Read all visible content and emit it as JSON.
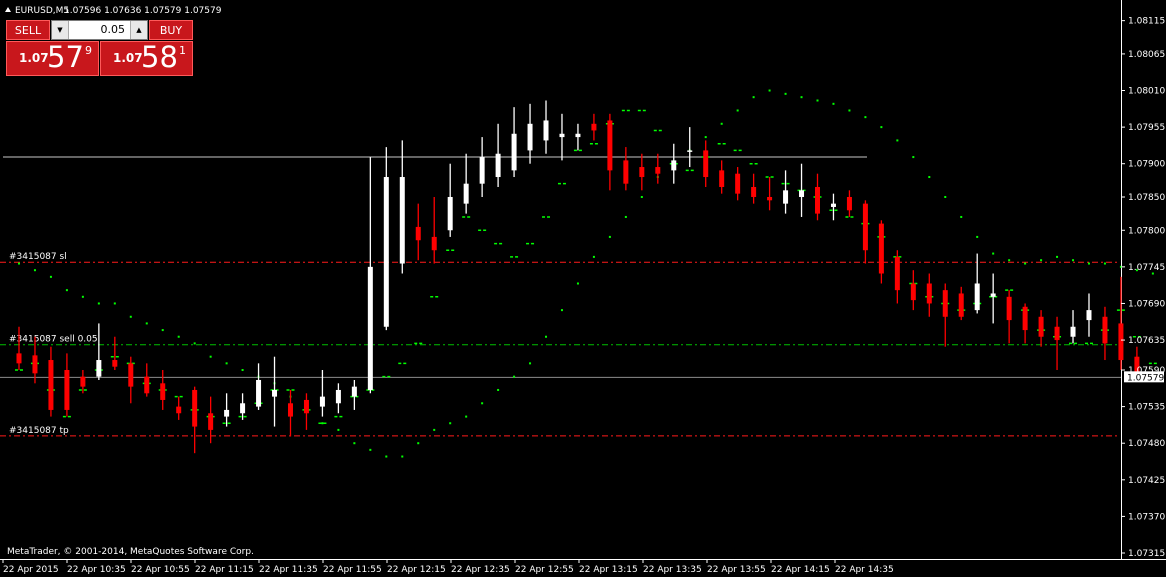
{
  "header": {
    "symbol": "EURUSD,M5",
    "ohlc": "1.07596 1.07636 1.07579 1.07579"
  },
  "trade_panel": {
    "sell_label": "SELL",
    "buy_label": "BUY",
    "lot": "0.05",
    "sell_price": {
      "big": "1.07",
      "main": "57",
      "sup": "9"
    },
    "buy_price": {
      "big": "1.07",
      "main": "58",
      "sup": "1"
    }
  },
  "copyright": "MetaTrader, © 2001-2014, MetaQuotes Software Corp.",
  "order_lines": {
    "sl_label": "#3415087 sl",
    "entry_label": "#3415087 sell 0.05",
    "tp_label": "#3415087 tp"
  },
  "current_price": "1.07579",
  "colors": {
    "background": "#000000",
    "bull": "#ffffff",
    "bear": "#ff0000",
    "moving_average": "#00ff00",
    "sar_dots": "#00ff00",
    "order_line": "#ff0000",
    "entry_line": "#00c000",
    "price_label_bg": "#ffffff"
  },
  "chart_data": {
    "type": "candlestick",
    "symbol": "EURUSD",
    "timeframe": "M5",
    "y_ticks": [
      "1.08115",
      "1.08065",
      "1.08010",
      "1.07955",
      "1.07900",
      "1.07850",
      "1.07800",
      "1.07745",
      "1.07690",
      "1.07635",
      "1.07590",
      "1.07535",
      "1.07480",
      "1.07425",
      "1.07370",
      "1.07315"
    ],
    "x_ticks": [
      "22 Apr 2015",
      "22 Apr 10:35",
      "22 Apr 10:55",
      "22 Apr 11:15",
      "22 Apr 11:35",
      "22 Apr 11:55",
      "22 Apr 12:15",
      "22 Apr 12:35",
      "22 Apr 12:55",
      "22 Apr 13:15",
      "22 Apr 13:35",
      "22 Apr 13:55",
      "22 Apr 14:15",
      "22 Apr 14:35"
    ],
    "ylim": [
      1.07309,
      1.08137
    ],
    "horizontal_lines": {
      "white_level": 1.0791,
      "stop_loss": 1.07752,
      "entry": 1.07628,
      "take_profit": 1.07491,
      "current": 1.07579
    },
    "candles": [
      {
        "o": 1.07615,
        "h": 1.07655,
        "l": 1.0759,
        "c": 1.076
      },
      {
        "o": 1.07612,
        "h": 1.0764,
        "l": 1.0757,
        "c": 1.07585
      },
      {
        "o": 1.07605,
        "h": 1.07625,
        "l": 1.0752,
        "c": 1.0753
      },
      {
        "o": 1.0759,
        "h": 1.07615,
        "l": 1.0752,
        "c": 1.0753
      },
      {
        "o": 1.0758,
        "h": 1.0759,
        "l": 1.07555,
        "c": 1.07565
      },
      {
        "o": 1.0758,
        "h": 1.0766,
        "l": 1.07575,
        "c": 1.07605
      },
      {
        "o": 1.07605,
        "h": 1.0764,
        "l": 1.0759,
        "c": 1.07595
      },
      {
        "o": 1.076,
        "h": 1.0761,
        "l": 1.0754,
        "c": 1.07565
      },
      {
        "o": 1.0758,
        "h": 1.076,
        "l": 1.0755,
        "c": 1.07555
      },
      {
        "o": 1.0757,
        "h": 1.0759,
        "l": 1.0753,
        "c": 1.07545
      },
      {
        "o": 1.07535,
        "h": 1.0755,
        "l": 1.07515,
        "c": 1.07525
      },
      {
        "o": 1.0756,
        "h": 1.07565,
        "l": 1.07465,
        "c": 1.07505
      },
      {
        "o": 1.07525,
        "h": 1.0755,
        "l": 1.0748,
        "c": 1.075
      },
      {
        "o": 1.0752,
        "h": 1.07555,
        "l": 1.07505,
        "c": 1.0753
      },
      {
        "o": 1.07525,
        "h": 1.07555,
        "l": 1.07515,
        "c": 1.0754
      },
      {
        "o": 1.07535,
        "h": 1.076,
        "l": 1.0753,
        "c": 1.07575
      },
      {
        "o": 1.0755,
        "h": 1.0761,
        "l": 1.07505,
        "c": 1.0756
      },
      {
        "o": 1.0754,
        "h": 1.0756,
        "l": 1.0749,
        "c": 1.0752
      },
      {
        "o": 1.07545,
        "h": 1.07555,
        "l": 1.075,
        "c": 1.07525
      },
      {
        "o": 1.07535,
        "h": 1.0759,
        "l": 1.0752,
        "c": 1.0755
      },
      {
        "o": 1.0754,
        "h": 1.0757,
        "l": 1.07525,
        "c": 1.0756
      },
      {
        "o": 1.0755,
        "h": 1.07575,
        "l": 1.0753,
        "c": 1.07565
      },
      {
        "o": 1.0756,
        "h": 1.0791,
        "l": 1.07555,
        "c": 1.07745
      },
      {
        "o": 1.07655,
        "h": 1.07925,
        "l": 1.0765,
        "c": 1.0788
      },
      {
        "o": 1.0775,
        "h": 1.07935,
        "l": 1.07735,
        "c": 1.0788
      },
      {
        "o": 1.07805,
        "h": 1.0784,
        "l": 1.07755,
        "c": 1.07785
      },
      {
        "o": 1.0779,
        "h": 1.0785,
        "l": 1.0775,
        "c": 1.0777
      },
      {
        "o": 1.078,
        "h": 1.079,
        "l": 1.0779,
        "c": 1.0785
      },
      {
        "o": 1.0784,
        "h": 1.07915,
        "l": 1.07825,
        "c": 1.0787
      },
      {
        "o": 1.0787,
        "h": 1.0794,
        "l": 1.0785,
        "c": 1.0791
      },
      {
        "o": 1.0788,
        "h": 1.0796,
        "l": 1.07865,
        "c": 1.07915
      },
      {
        "o": 1.0789,
        "h": 1.07985,
        "l": 1.0788,
        "c": 1.07945
      },
      {
        "o": 1.0792,
        "h": 1.0799,
        "l": 1.079,
        "c": 1.0796
      },
      {
        "o": 1.07935,
        "h": 1.07995,
        "l": 1.07915,
        "c": 1.07965
      },
      {
        "o": 1.0794,
        "h": 1.07975,
        "l": 1.07905,
        "c": 1.07945
      },
      {
        "o": 1.0794,
        "h": 1.0796,
        "l": 1.0792,
        "c": 1.07945
      },
      {
        "o": 1.0796,
        "h": 1.07975,
        "l": 1.07935,
        "c": 1.0795
      },
      {
        "o": 1.07965,
        "h": 1.07975,
        "l": 1.0786,
        "c": 1.0789
      },
      {
        "o": 1.07905,
        "h": 1.07925,
        "l": 1.0786,
        "c": 1.0787
      },
      {
        "o": 1.07895,
        "h": 1.07915,
        "l": 1.0786,
        "c": 1.0788
      },
      {
        "o": 1.07895,
        "h": 1.07915,
        "l": 1.0787,
        "c": 1.07885
      },
      {
        "o": 1.0789,
        "h": 1.0793,
        "l": 1.0787,
        "c": 1.07905
      },
      {
        "o": 1.0792,
        "h": 1.07955,
        "l": 1.07895,
        "c": 1.0792
      },
      {
        "o": 1.0792,
        "h": 1.07935,
        "l": 1.07865,
        "c": 1.0788
      },
      {
        "o": 1.0789,
        "h": 1.07905,
        "l": 1.07855,
        "c": 1.07865
      },
      {
        "o": 1.07885,
        "h": 1.07895,
        "l": 1.07845,
        "c": 1.07855
      },
      {
        "o": 1.07865,
        "h": 1.07885,
        "l": 1.0784,
        "c": 1.0785
      },
      {
        "o": 1.0785,
        "h": 1.0788,
        "l": 1.0783,
        "c": 1.07845
      },
      {
        "o": 1.0784,
        "h": 1.0789,
        "l": 1.07825,
        "c": 1.0786
      },
      {
        "o": 1.0785,
        "h": 1.079,
        "l": 1.0782,
        "c": 1.0786
      },
      {
        "o": 1.07865,
        "h": 1.07885,
        "l": 1.07815,
        "c": 1.07825
      },
      {
        "o": 1.07835,
        "h": 1.07855,
        "l": 1.07815,
        "c": 1.0784
      },
      {
        "o": 1.0785,
        "h": 1.0786,
        "l": 1.0782,
        "c": 1.0783
      },
      {
        "o": 1.0784,
        "h": 1.07845,
        "l": 1.0775,
        "c": 1.0777
      },
      {
        "o": 1.0781,
        "h": 1.07815,
        "l": 1.0772,
        "c": 1.07735
      },
      {
        "o": 1.0776,
        "h": 1.0777,
        "l": 1.0769,
        "c": 1.0771
      },
      {
        "o": 1.0772,
        "h": 1.0774,
        "l": 1.0768,
        "c": 1.07695
      },
      {
        "o": 1.0772,
        "h": 1.07735,
        "l": 1.0767,
        "c": 1.0769
      },
      {
        "o": 1.0771,
        "h": 1.0772,
        "l": 1.07625,
        "c": 1.0767
      },
      {
        "o": 1.07705,
        "h": 1.07715,
        "l": 1.07665,
        "c": 1.0767
      },
      {
        "o": 1.0768,
        "h": 1.07765,
        "l": 1.07675,
        "c": 1.0772
      },
      {
        "o": 1.077,
        "h": 1.07735,
        "l": 1.0766,
        "c": 1.07705
      },
      {
        "o": 1.077,
        "h": 1.0771,
        "l": 1.0763,
        "c": 1.07665
      },
      {
        "o": 1.07685,
        "h": 1.0769,
        "l": 1.0763,
        "c": 1.0765
      },
      {
        "o": 1.0767,
        "h": 1.0768,
        "l": 1.07625,
        "c": 1.0764
      },
      {
        "o": 1.07655,
        "h": 1.0767,
        "l": 1.0759,
        "c": 1.07635
      },
      {
        "o": 1.0764,
        "h": 1.0768,
        "l": 1.0763,
        "c": 1.07655
      },
      {
        "o": 1.07665,
        "h": 1.07705,
        "l": 1.0764,
        "c": 1.0768
      },
      {
        "o": 1.0767,
        "h": 1.07685,
        "l": 1.07605,
        "c": 1.0763
      },
      {
        "o": 1.0766,
        "h": 1.0773,
        "l": 1.0759,
        "c": 1.07605
      },
      {
        "o": 1.0761,
        "h": 1.07625,
        "l": 1.07578,
        "c": 1.07585
      }
    ],
    "moving_average_series": [
      1.0759,
      1.076,
      1.0756,
      1.0752,
      1.0756,
      1.0759,
      1.0761,
      1.076,
      1.0757,
      1.0756,
      1.0755,
      1.0753,
      1.0752,
      1.0751,
      1.0752,
      1.0754,
      1.0756,
      1.0756,
      1.0753,
      1.0751,
      1.0752,
      1.0755,
      1.0756,
      1.0758,
      1.076,
      1.0763,
      1.077,
      1.0777,
      1.0782,
      1.078,
      1.0778,
      1.0776,
      1.0778,
      1.0782,
      1.0787,
      1.0792,
      1.0793,
      1.0796,
      1.0798,
      1.0798,
      1.0795,
      1.079,
      1.0789,
      1.0791,
      1.0793,
      1.0792,
      1.079,
      1.0788,
      1.0787,
      1.0786,
      1.0785,
      1.0783,
      1.0782,
      1.0781,
      1.0779,
      1.0776,
      1.0772,
      1.077,
      1.0769,
      1.0768,
      1.0769,
      1.077,
      1.0771,
      1.0768,
      1.0765,
      1.0764,
      1.0763,
      1.0763,
      1.0765,
      1.0768,
      1.0764,
      1.076
    ],
    "parabolic_sar": [
      1.0775,
      1.0774,
      1.0773,
      1.0771,
      1.077,
      1.0769,
      1.0769,
      1.0767,
      1.0766,
      1.0765,
      1.0764,
      1.0763,
      1.0761,
      1.076,
      1.0759,
      1.0758,
      1.0757,
      1.0755,
      1.0753,
      1.0751,
      1.075,
      1.0748,
      1.0747,
      1.0746,
      1.0746,
      1.0748,
      1.075,
      1.0751,
      1.0752,
      1.0754,
      1.0756,
      1.0758,
      1.076,
      1.0764,
      1.0768,
      1.0772,
      1.0776,
      1.0779,
      1.0782,
      1.0785,
      1.0788,
      1.079,
      1.0792,
      1.0794,
      1.0796,
      1.0798,
      1.08,
      1.0801,
      1.08005,
      1.08,
      1.07995,
      1.0799,
      1.0798,
      1.0797,
      1.07955,
      1.07935,
      1.0791,
      1.0788,
      1.0785,
      1.0782,
      1.0779,
      1.07765,
      1.07755,
      1.0775,
      1.07755,
      1.0776,
      1.07755,
      1.0775,
      1.0775,
      1.07745,
      1.0774,
      1.07735
    ]
  }
}
